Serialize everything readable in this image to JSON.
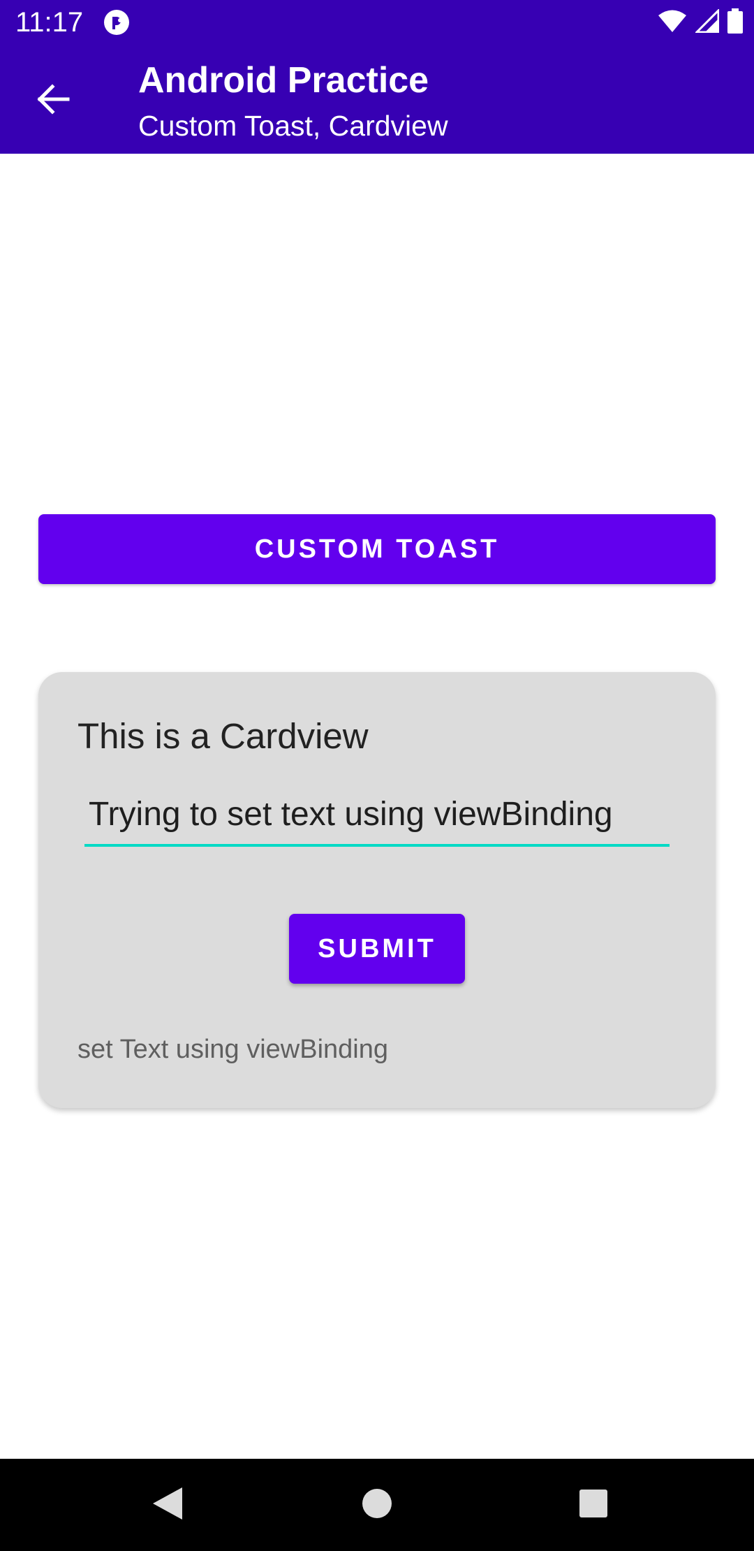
{
  "status_bar": {
    "time": "11:17",
    "icons": [
      "app-notification-icon",
      "wifi-icon",
      "signal-icon",
      "battery-icon"
    ]
  },
  "app_bar": {
    "title": "Android Practice",
    "subtitle": "Custom Toast, Cardview",
    "back_icon": "arrow-back-icon"
  },
  "main": {
    "custom_toast_label": "CUSTOM TOAST"
  },
  "card": {
    "title": "This is a Cardview",
    "input_value": "Trying to set text using viewBinding",
    "submit_label": "SUBMIT",
    "result_text": "set Text using viewBinding"
  },
  "nav_bar": {
    "buttons": [
      "back-triangle-icon",
      "home-circle-icon",
      "recents-square-icon"
    ]
  },
  "colors": {
    "primary_dark": "#3700B3",
    "primary": "#6200EE",
    "accent": "#03DAC5",
    "card_bg": "#DCDCDC"
  }
}
